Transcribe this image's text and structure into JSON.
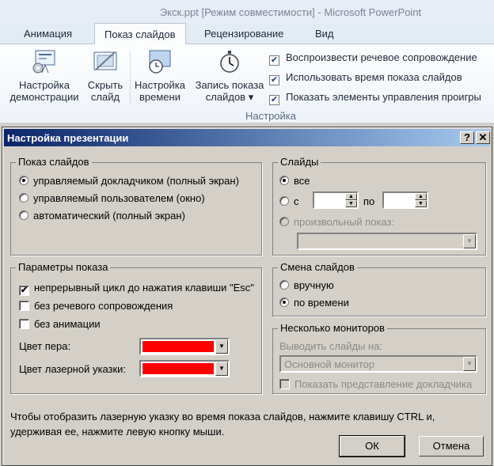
{
  "window": {
    "title": "Экск.ppt [Режим совместимости]  -  Microsoft PowerPoint"
  },
  "tabs": {
    "animation": "Анимация",
    "slideshow": "Показ слайдов",
    "review": "Рецензирование",
    "view": "Вид"
  },
  "ribbon": {
    "setup_show": [
      "Настройка",
      "демонстрации"
    ],
    "hide_slide": [
      "Скрыть",
      "слайд"
    ],
    "rehearse": [
      "Настройка",
      "времени"
    ],
    "record": [
      "Запись показа",
      "слайдов ▾"
    ],
    "checks": [
      {
        "label": "Воспроизвести речевое сопровождение",
        "checked": true
      },
      {
        "label": "Использовать время показа слайдов",
        "checked": true
      },
      {
        "label": "Показать элементы управления проигры",
        "checked": true
      }
    ],
    "group_label": "Настройка"
  },
  "dialog": {
    "title": "Настройка презентации",
    "help": "?",
    "close": "✕",
    "show_type": {
      "title": "Показ слайдов",
      "options": [
        "управляемый докладчиком (полный экран)",
        "управляемый пользователем (окно)",
        "автоматический (полный экран)"
      ],
      "selected": 0
    },
    "slides": {
      "title": "Слайды",
      "all": "все",
      "from": "с",
      "to": "по",
      "custom": "произвольный показ:",
      "from_value": "",
      "to_value": "",
      "custom_value": ""
    },
    "show_options": {
      "title": "Параметры показа",
      "loop": "непрерывный цикл до нажатия клавиши \"Esc\"",
      "no_narration": "без речевого сопровождения",
      "no_animation": "без анимации",
      "loop_checked": true,
      "pen_color_label": "Цвет пера:",
      "laser_color_label": "Цвет лазерной указки:",
      "pen_color": "#ff0000",
      "laser_color": "#ff0000"
    },
    "advance": {
      "title": "Смена слайдов",
      "manual": "вручную",
      "timings": "по времени",
      "selected": "timings"
    },
    "monitors": {
      "title": "Несколько мониторов",
      "display_on": "Выводить слайды на:",
      "display_value": "Основной монитор",
      "presenter_view": "Показать представление докладчика"
    },
    "hint": "Чтобы отобразить лазерную указку во время показа слайдов, нажмите клавишу CTRL и, удерживая ее, нажмите левую кнопку мыши.",
    "ok": "ОК",
    "cancel": "Отмена"
  }
}
